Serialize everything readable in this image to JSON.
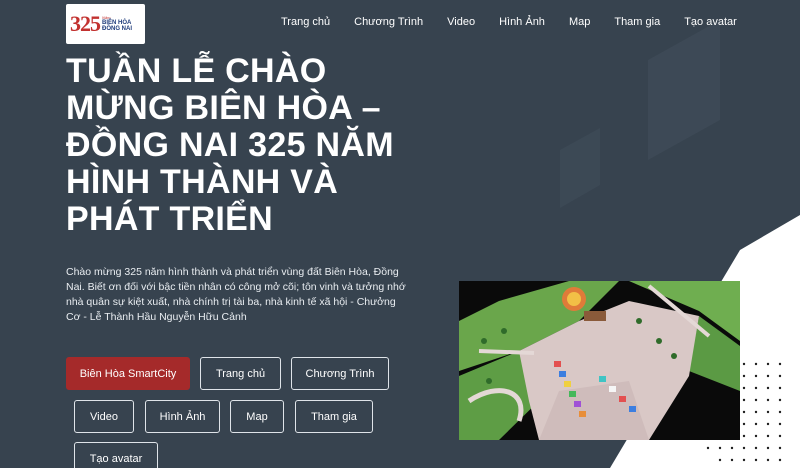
{
  "logo": {
    "number": "325",
    "line_small": "Năm",
    "line1": "BIÊN HÒA",
    "line2": "ĐỒNG NAI"
  },
  "nav": {
    "items": [
      "Trang chủ",
      "Chương Trình",
      "Video",
      "Hình Ảnh",
      "Map",
      "Tham gia",
      "Tạo avatar"
    ]
  },
  "hero": {
    "title": "Tuần Lễ Chào Mừng Biên Hòa – Đồng Nai 325 Năm Hình Thành Và Phát Triển",
    "description": "Chào mừng 325 năm hình thành và phát triển vùng đất Biên Hòa, Đồng Nai. Biết ơn đối với bậc tiền nhân có công mở cõi; tôn vinh và tưởng nhớ nhà quân sự kiệt xuất, nhà chính trị tài ba, nhà kinh tế xã hội - Chưởng Cơ - Lễ Thành Hầu Nguyễn Hữu Cảnh"
  },
  "buttons": {
    "primary": "Biên Hòa SmartCity",
    "home": "Trang chủ",
    "program": "Chương Trình",
    "video": "Video",
    "gallery": "Hình Ảnh",
    "map": "Map",
    "join": "Tham gia",
    "avatar": "Tạo avatar"
  },
  "colors": {
    "background": "#37434f",
    "primary_button": "#a52a2a",
    "text": "#ffffff"
  }
}
